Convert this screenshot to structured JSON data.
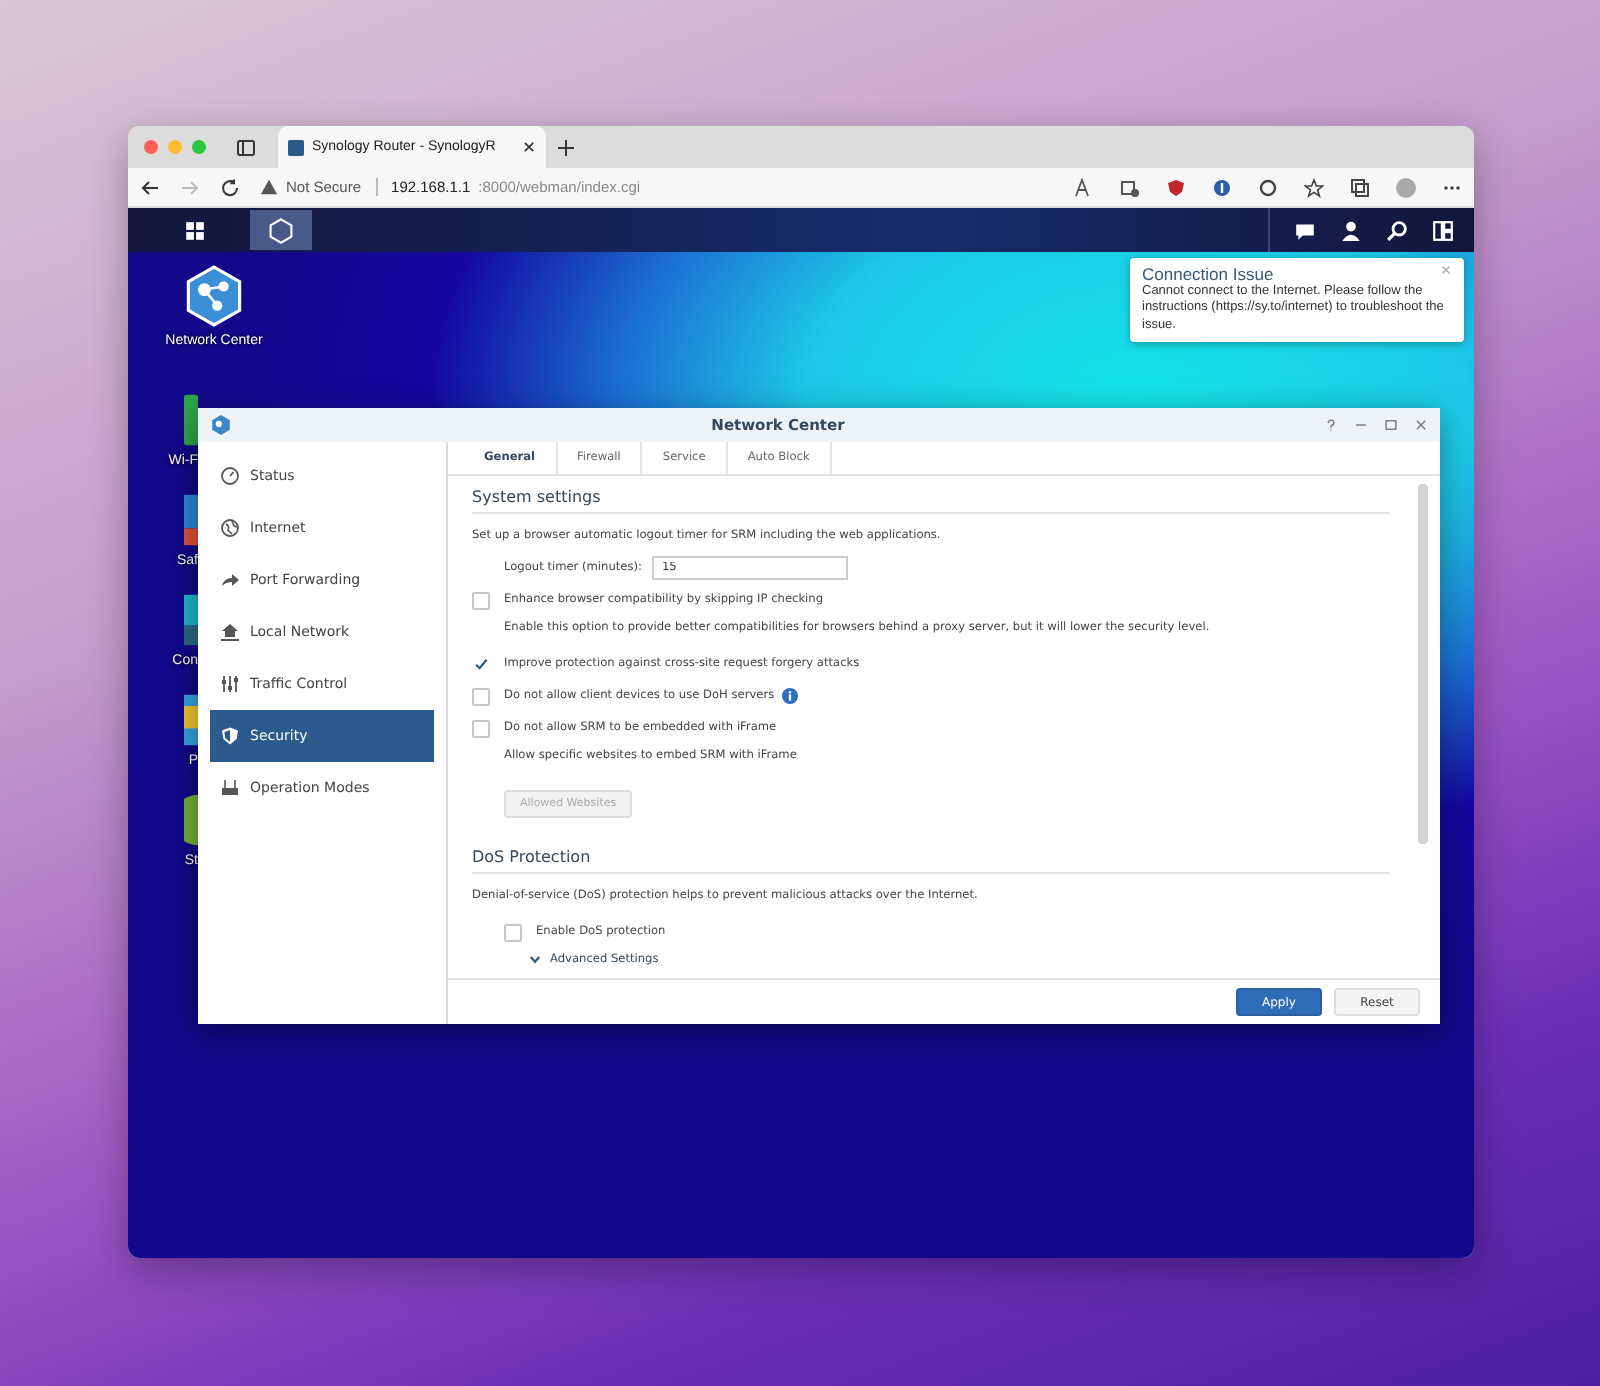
{
  "browser": {
    "tab_title": "Synology Router - SynologyR",
    "security_label": "Not Secure",
    "url_host": "192.168.1.1",
    "url_path": ":8000/webman/index.cgi"
  },
  "desktop_icons": [
    {
      "label": "Network Center",
      "kind": "network"
    },
    {
      "label": "Wi-F",
      "kind": "wifi"
    },
    {
      "label": "Saf",
      "kind": "safe"
    },
    {
      "label": "Con",
      "kind": "connect"
    },
    {
      "label": "P",
      "kind": "folder"
    },
    {
      "label": "St",
      "kind": "round"
    }
  ],
  "notification": {
    "title": "Connection Issue",
    "body": "Cannot connect to the Internet. Please follow the instructions (https://sy.to/internet) to troubleshoot the issue."
  },
  "app_window": {
    "title": "Network Center",
    "sidebar": [
      {
        "label": "Status",
        "selected": false
      },
      {
        "label": "Internet",
        "selected": false
      },
      {
        "label": "Port Forwarding",
        "selected": false
      },
      {
        "label": "Local Network",
        "selected": false
      },
      {
        "label": "Traffic Control",
        "selected": false
      },
      {
        "label": "Security",
        "selected": true
      },
      {
        "label": "Operation Modes",
        "selected": false
      }
    ],
    "tabs": [
      {
        "label": "General",
        "selected": true
      },
      {
        "label": "Firewall",
        "selected": false
      },
      {
        "label": "Service",
        "selected": false
      },
      {
        "label": "Auto Block",
        "selected": false
      }
    ],
    "sections": [
      {
        "heading": "System settings",
        "items": [
          {
            "kind": "text",
            "text": "Set up a browser automatic logout timer for SRM including the web applications."
          },
          {
            "kind": "field",
            "label": "Logout timer (minutes):",
            "value": "15"
          },
          {
            "kind": "checkbox",
            "label": "Enhance browser compatibility by skipping IP checking",
            "checked": false
          },
          {
            "kind": "note",
            "text": "Enable this option to provide better compatibilities for browsers behind a proxy server, but it will lower the security level."
          },
          {
            "kind": "checkbox",
            "label": "Improve protection against cross-site request forgery attacks",
            "checked": true
          },
          {
            "kind": "checkbox",
            "label": "Do not allow client devices to use DoH servers",
            "checked": false,
            "info": true
          },
          {
            "kind": "checkbox",
            "label": "Do not allow SRM to be embedded with iFrame",
            "checked": false
          },
          {
            "kind": "note",
            "text": "Allow specific websites to embed SRM with iFrame"
          },
          {
            "kind": "button",
            "label": "Allowed Websites",
            "disabled": true
          }
        ]
      },
      {
        "heading": "DoS Protection",
        "items": [
          {
            "kind": "text",
            "text": "Denial-of-service (DoS) protection helps to prevent malicious attacks over the Internet."
          },
          {
            "kind": "checkbox",
            "label": "Enable DoS protection",
            "checked": false
          },
          {
            "kind": "expander",
            "label": "Advanced Settings",
            "expanded": false
          }
        ]
      }
    ],
    "footer_buttons": [
      {
        "label": "Apply",
        "kind": "primary"
      },
      {
        "label": "Reset",
        "kind": "secondary"
      }
    ]
  }
}
